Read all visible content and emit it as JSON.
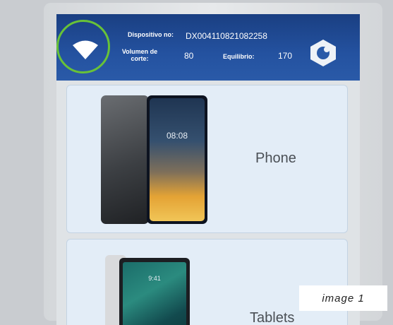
{
  "header": {
    "device_label": "Dispositivo no:",
    "device_id": "DX004110821082258",
    "volume_label": "Volumen de corte:",
    "volume_value": "80",
    "balance_label": "Equilibrio:",
    "balance_value": "170"
  },
  "cards": [
    {
      "label": "Phone",
      "screen_time": "08:08"
    },
    {
      "label": "Tablets",
      "screen_time": "9:41"
    }
  ],
  "caption": "image 1",
  "colors": {
    "header": "#2452a0",
    "highlight_ring": "#68c238",
    "card_bg": "#e3edf7"
  }
}
